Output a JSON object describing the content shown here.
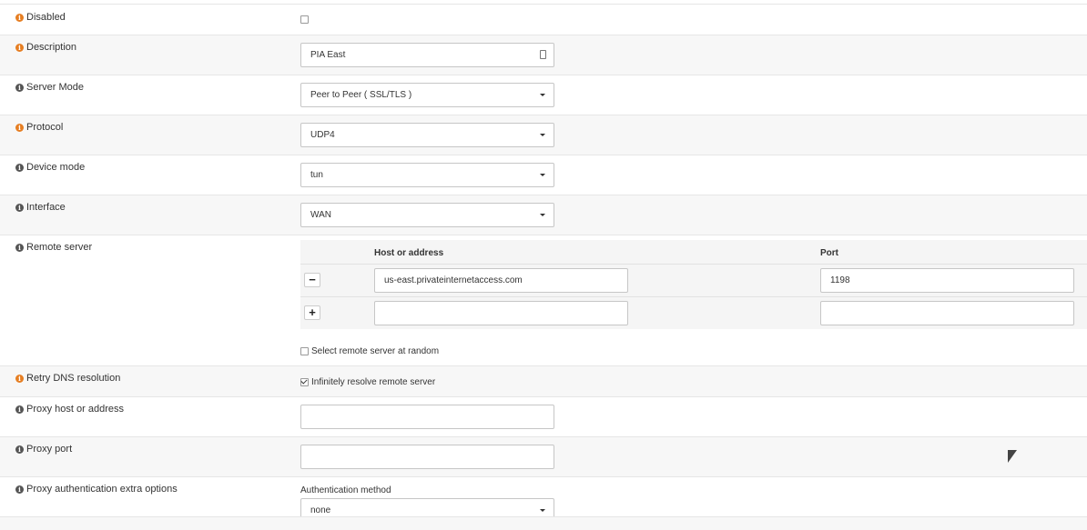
{
  "rows": {
    "disabled": {
      "label": "Disabled"
    },
    "description": {
      "label": "Description",
      "value": "PIA East"
    },
    "server_mode": {
      "label": "Server Mode",
      "value": "Peer to Peer ( SSL/TLS )"
    },
    "protocol": {
      "label": "Protocol",
      "value": "UDP4"
    },
    "device_mode": {
      "label": "Device mode",
      "value": "tun"
    },
    "interface": {
      "label": "Interface",
      "value": "WAN"
    },
    "remote_server": {
      "label": "Remote server",
      "col_host": "Host or address",
      "col_port": "Port",
      "entries": [
        {
          "host": "us-east.privateinternetaccess.com",
          "port": "1198",
          "button": "−"
        },
        {
          "host": "",
          "port": "",
          "button": "+"
        }
      ],
      "random_label": "Select remote server at random"
    },
    "retry_dns": {
      "label": "Retry DNS resolution",
      "checkbox_label": "Infinitely resolve remote server"
    },
    "proxy_host": {
      "label": "Proxy host or address",
      "value": ""
    },
    "proxy_port": {
      "label": "Proxy port",
      "value": ""
    },
    "proxy_auth": {
      "label": "Proxy authentication extra options",
      "sublabel": "Authentication method",
      "value": "none"
    }
  },
  "info_icon_glyph": "i",
  "colors": {
    "required": "#e67e22",
    "optional": "#555555"
  }
}
